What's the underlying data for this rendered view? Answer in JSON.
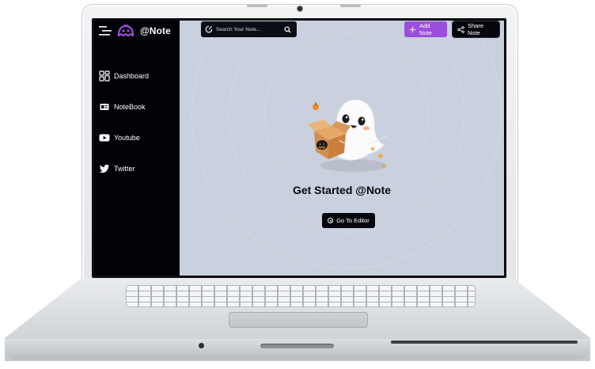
{
  "app": {
    "brand": "@Note",
    "accent_color": "#9d4edd",
    "sidebar_bg": "#000207",
    "content_bg": "#c9d1de"
  },
  "sidebar": {
    "items": [
      {
        "label": "Dashboard",
        "icon": "dashboard-icon"
      },
      {
        "label": "NoteBook",
        "icon": "notebook-icon"
      },
      {
        "label": "Youtube",
        "icon": "youtube-icon"
      },
      {
        "label": "Twitter",
        "icon": "twitter-icon"
      }
    ]
  },
  "search": {
    "placeholder": "Search Your Note...",
    "value": ""
  },
  "toolbar": {
    "add_label": "Add Note",
    "share_label": "Share Note"
  },
  "main": {
    "headline": "Get Started @Note",
    "cta_label": "Go To Editor",
    "illustration": "ghost-holding-pumpkin-box"
  }
}
